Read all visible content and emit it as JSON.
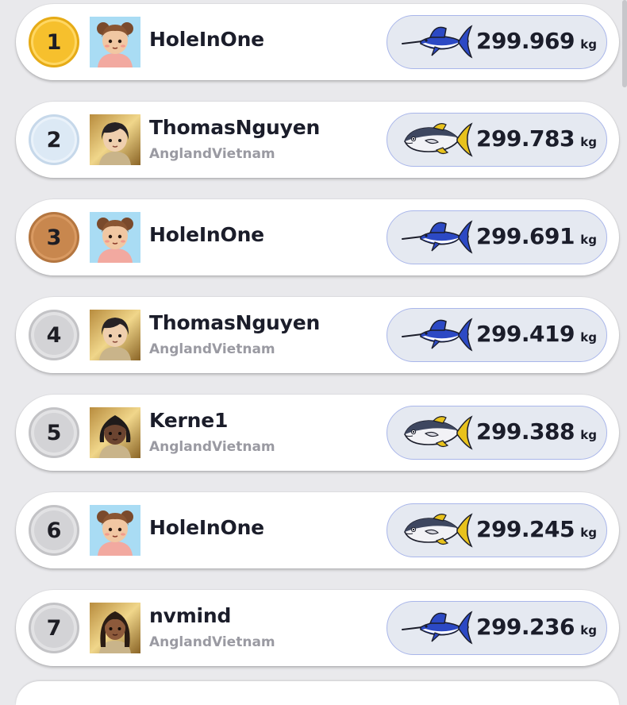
{
  "leaderboard": {
    "unit_label": "kg",
    "entries": [
      {
        "rank": "1",
        "rank_style": "gold",
        "player": "HoleInOne",
        "team": "",
        "avatar": "bear-ears-avatar",
        "fish": "marlin-icon",
        "weight": "299.969"
      },
      {
        "rank": "2",
        "rank_style": "silver",
        "player": "ThomasNguyen",
        "team": "AnglandVietnam",
        "avatar": "dark-hair-avatar",
        "fish": "tuna-icon",
        "weight": "299.783"
      },
      {
        "rank": "3",
        "rank_style": "bronze",
        "player": "HoleInOne",
        "team": "",
        "avatar": "bear-ears-avatar",
        "fish": "marlin-icon",
        "weight": "299.691"
      },
      {
        "rank": "4",
        "rank_style": "plain",
        "player": "ThomasNguyen",
        "team": "AnglandVietnam",
        "avatar": "dark-hair-avatar",
        "fish": "marlin-icon",
        "weight": "299.419"
      },
      {
        "rank": "5",
        "rank_style": "plain",
        "player": "Kerne1",
        "team": "AnglandVietnam",
        "avatar": "braids-avatar",
        "fish": "tuna-icon",
        "weight": "299.388"
      },
      {
        "rank": "6",
        "rank_style": "plain",
        "player": "HoleInOne",
        "team": "",
        "avatar": "bear-ears-avatar",
        "fish": "tuna-icon",
        "weight": "299.245"
      },
      {
        "rank": "7",
        "rank_style": "plain",
        "player": "nvmind",
        "team": "AnglandVietnam",
        "avatar": "long-hair-avatar",
        "fish": "marlin-icon",
        "weight": "299.236"
      }
    ]
  },
  "colors": {
    "gold": "#f6c02d",
    "silver": "#dce9f5",
    "bronze": "#c8874e",
    "plain": "#d3d3d6",
    "pill_background": "#e5e9f1",
    "pill_border": "#a9b6ea",
    "marlin": "#2c49c4",
    "tuna_fin": "#e8c21c"
  }
}
